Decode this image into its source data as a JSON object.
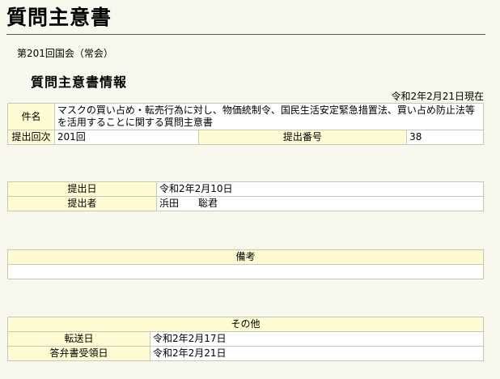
{
  "page_title": "質問主意書",
  "session": "第201回国会（常会）",
  "section_heading": "質問主意書情報",
  "as_of": "令和2年2月21日現在",
  "main": {
    "subject_label": "件名",
    "subject_value": "マスクの買い占め・転売行為に対し、物価統制令、国民生活安定緊急措置法、買い占め防止法等を活用することに関する質問主意書",
    "session_no_label": "提出回次",
    "session_no_value": "201回",
    "submission_no_label": "提出番号",
    "submission_no_value": "38"
  },
  "dates": {
    "submitted_date_label": "提出日",
    "submitted_date_value": "令和2年2月10日",
    "submitter_label": "提出者",
    "submitter_value": "浜田　　聡君"
  },
  "remarks": {
    "header": "備考",
    "value": ""
  },
  "other": {
    "header": "その他",
    "transfer_date_label": "転送日",
    "transfer_date_value": "令和2年2月17日",
    "answer_received_label": "答弁書受領日",
    "answer_received_value": "令和2年2月21日"
  }
}
